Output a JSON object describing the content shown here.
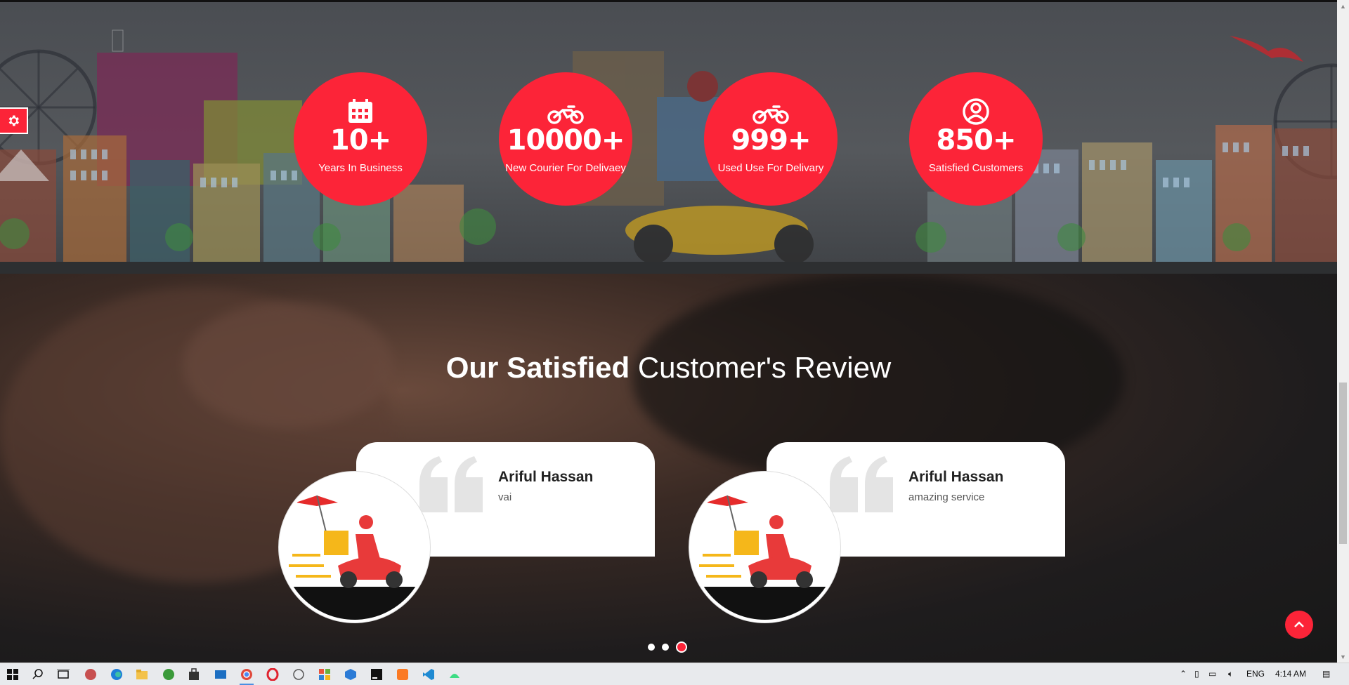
{
  "stats": [
    {
      "icon": "calendar-icon",
      "value": "10+",
      "label": "Years In Business"
    },
    {
      "icon": "motorcycle-icon",
      "value": "10000+",
      "label": "New Courier For Delivaey"
    },
    {
      "icon": "motorcycle-icon",
      "value": "999+",
      "label": "Used Use For Delivary"
    },
    {
      "icon": "user-circle-icon",
      "value": "850+",
      "label": "Satisfied Customers"
    }
  ],
  "reviews_section": {
    "heading_bold": "Our Satisfied",
    "heading_light": "Customer's Review",
    "reviews": [
      {
        "name": "Ariful Hassan",
        "text": "vai"
      },
      {
        "name": "Ariful Hassan",
        "text": "amazing service"
      }
    ],
    "carousel_dots": 3,
    "active_dot": 3
  },
  "colors": {
    "accent": "#fc2438"
  },
  "taskbar": {
    "language": "ENG",
    "time": "4:14 AM"
  }
}
